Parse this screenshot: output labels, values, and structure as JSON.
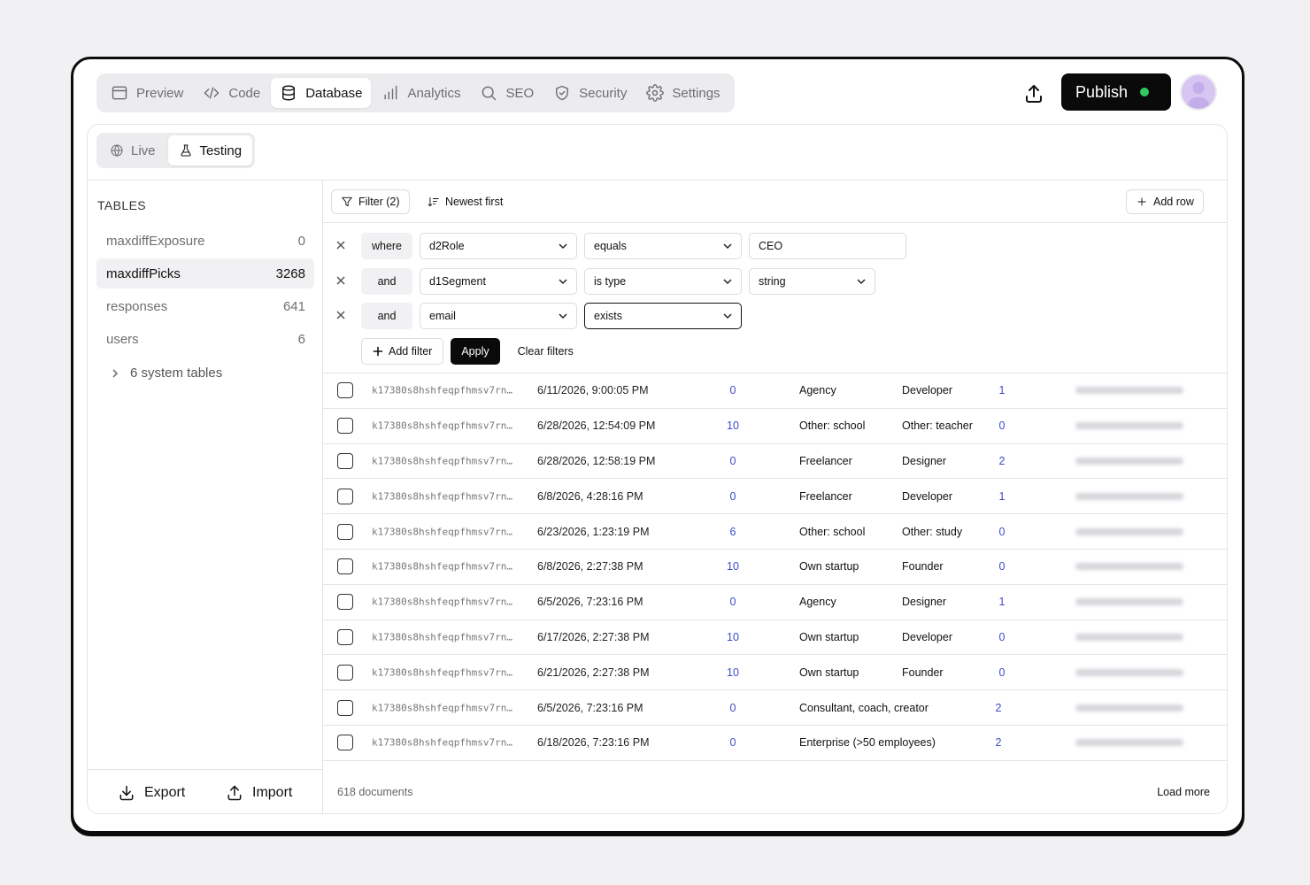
{
  "nav": {
    "tabs": [
      {
        "label": "Preview",
        "icon": "preview-icon"
      },
      {
        "label": "Code",
        "icon": "code-icon"
      },
      {
        "label": "Database",
        "icon": "database-icon"
      },
      {
        "label": "Analytics",
        "icon": "analytics-icon"
      },
      {
        "label": "SEO",
        "icon": "search-icon"
      },
      {
        "label": "Security",
        "icon": "shield-icon"
      },
      {
        "label": "Settings",
        "icon": "gear-icon"
      }
    ],
    "active_tab": "Database",
    "publish_label": "Publish",
    "publish_status_color": "#2fc95e"
  },
  "env": {
    "tabs": [
      {
        "label": "Live",
        "icon": "globe-icon"
      },
      {
        "label": "Testing",
        "icon": "flask-icon"
      }
    ],
    "active": "Testing"
  },
  "sidebar": {
    "heading": "TABLES",
    "tables": [
      {
        "name": "maxdiffExposure",
        "count": "0"
      },
      {
        "name": "maxdiffPicks",
        "count": "3268"
      },
      {
        "name": "responses",
        "count": "641"
      },
      {
        "name": "users",
        "count": "6"
      }
    ],
    "active_table": "maxdiffPicks",
    "system_tables": "6 system tables",
    "export_label": "Export",
    "import_label": "Import"
  },
  "toolbar": {
    "filter_label": "Filter (2)",
    "sort_label": "Newest first",
    "add_row_label": "Add row"
  },
  "filters": [
    {
      "conj": "where",
      "field": "d2Role",
      "op": "equals",
      "value": "CEO"
    },
    {
      "conj": "and",
      "field": "d1Segment",
      "op": "is type",
      "value": "string"
    },
    {
      "conj": "and",
      "field": "email",
      "op": "exists",
      "value": ""
    }
  ],
  "filter_actions": {
    "add_filter": "Add filter",
    "apply": "Apply",
    "clear": "Clear filters"
  },
  "rows": [
    {
      "id": "k17380s8hshfeqpfhmsv7rn…",
      "date": "6/11/2026, 9:00:05 PM",
      "num": "0",
      "segment": "Agency",
      "role": "Developer",
      "count": "1"
    },
    {
      "id": "k17380s8hshfeqpfhmsv7rn…",
      "date": "6/28/2026, 12:54:09 PM",
      "num": "10",
      "segment": "Other: school",
      "role": "Other: teacher",
      "count": "0"
    },
    {
      "id": "k17380s8hshfeqpfhmsv7rn…",
      "date": "6/28/2026, 12:58:19 PM",
      "num": "0",
      "segment": "Freelancer",
      "role": "Designer",
      "count": "2"
    },
    {
      "id": "k17380s8hshfeqpfhmsv7rn…",
      "date": "6/8/2026, 4:28:16 PM",
      "num": "0",
      "segment": "Freelancer",
      "role": "Developer",
      "count": "1"
    },
    {
      "id": "k17380s8hshfeqpfhmsv7rn…",
      "date": "6/23/2026, 1:23:19 PM",
      "num": "6",
      "segment": "Other: school",
      "role": "Other: study",
      "count": "0"
    },
    {
      "id": "k17380s8hshfeqpfhmsv7rn…",
      "date": "6/8/2026, 2:27:38 PM",
      "num": "10",
      "segment": "Own startup",
      "role": "Founder",
      "count": "0"
    },
    {
      "id": "k17380s8hshfeqpfhmsv7rn…",
      "date": "6/5/2026, 7:23:16 PM",
      "num": "0",
      "segment": "Agency",
      "role": "Designer",
      "count": "1"
    },
    {
      "id": "k17380s8hshfeqpfhmsv7rn…",
      "date": "6/17/2026, 2:27:38 PM",
      "num": "10",
      "segment": "Own startup",
      "role": "Developer",
      "count": "0"
    },
    {
      "id": "k17380s8hshfeqpfhmsv7rn…",
      "date": "6/21/2026, 2:27:38 PM",
      "num": "10",
      "segment": "Own startup",
      "role": "Founder",
      "count": "0"
    },
    {
      "id": "k17380s8hshfeqpfhmsv7rn…",
      "date": "6/5/2026, 7:23:16 PM",
      "num": "0",
      "segment": "Consultant, coach, creator",
      "role": "",
      "count": "2"
    },
    {
      "id": "k17380s8hshfeqpfhmsv7rn…",
      "date": "6/18/2026, 7:23:16 PM",
      "num": "0",
      "segment": "Enterprise (>50 employees)",
      "role": "",
      "count": "2"
    }
  ],
  "footer": {
    "doc_count": "618 documents",
    "load_more": "Load more"
  }
}
